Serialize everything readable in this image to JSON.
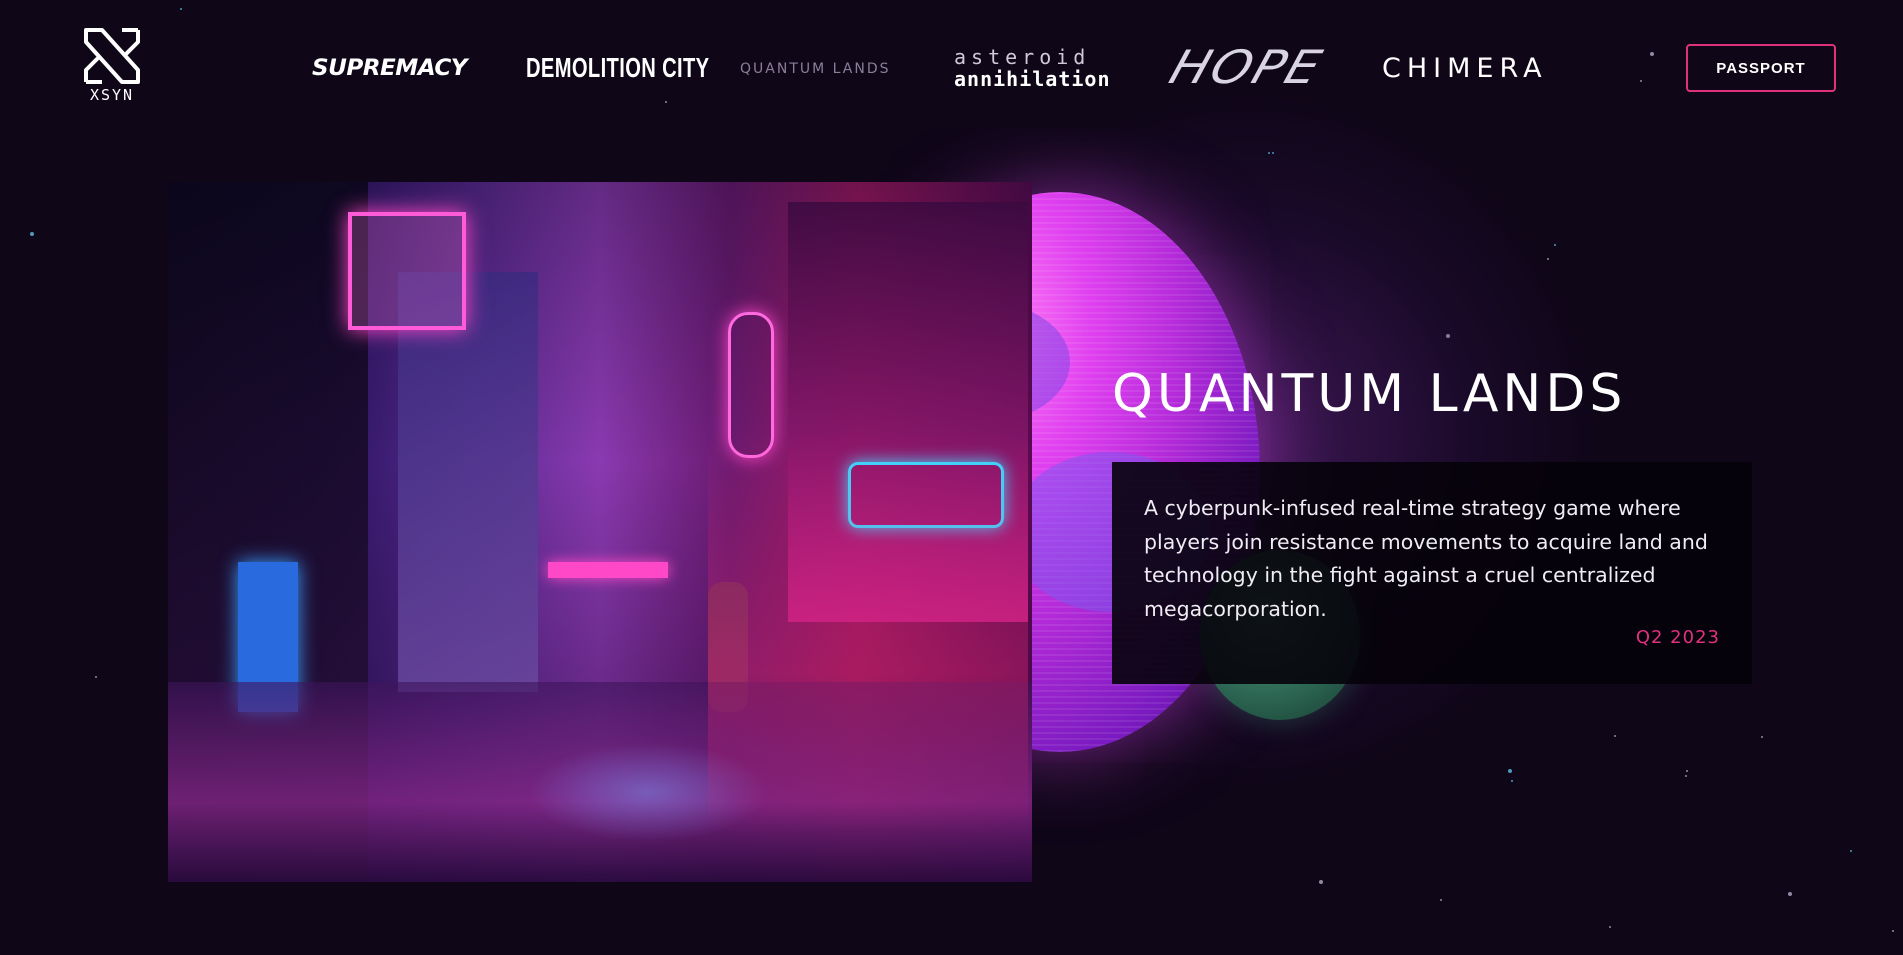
{
  "header": {
    "logo_text": "XSYN",
    "nav": [
      {
        "label": "SUPREMACY"
      },
      {
        "label": "DEMOLITION CITY"
      },
      {
        "label": "QUANTUM LANDS",
        "active": true
      },
      {
        "label_line1": "asteroid",
        "label_line2": "annihilation"
      },
      {
        "label": "HOPE"
      },
      {
        "label": "CHIMERA"
      }
    ],
    "passport_label": "PASSPORT"
  },
  "hero": {
    "title": "QUANTUM LANDS",
    "description": "A cyberpunk-infused real-time strategy game where players join resistance movements to acquire land and technology in the fight against a cruel centralized megacorporation.",
    "release": "Q2 2023"
  },
  "colors": {
    "background": "#0f0618",
    "accent": "#e0317e",
    "inactive_nav": "#8a7f9a"
  },
  "icons": {
    "logo": "xsyn-x-logo-icon"
  }
}
